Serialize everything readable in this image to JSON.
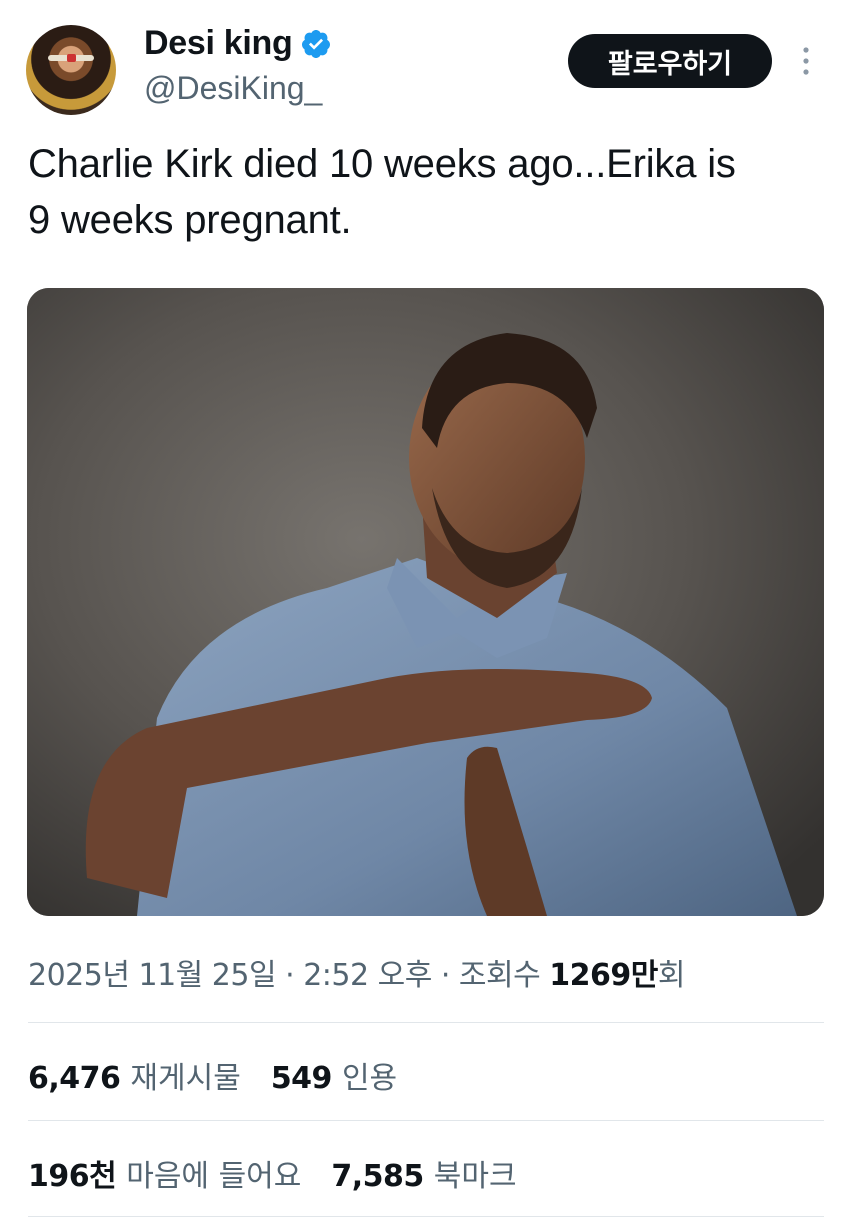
{
  "header": {
    "display_name": "Desi king",
    "handle": "@DesiKing_",
    "follow_label": "팔로우하기",
    "verified_icon": "verified-badge-icon",
    "more_icon": "more-vertical-icon",
    "accent_color": "#1d9bf0"
  },
  "tweet": {
    "text_line1": "Charlie Kirk died 10 weeks ago...Erika is",
    "text_line2": "9 weeks pregnant."
  },
  "meta": {
    "date": "2025년 11월 25일",
    "separator": " · ",
    "time": "2:52 오후",
    "views_label": "조회수",
    "views_count": "1269",
    "views_unit_1": "만",
    "views_unit_2": "회"
  },
  "stats": {
    "reposts_count": "6,476",
    "reposts_label": "재게시물",
    "quotes_count": "549",
    "quotes_label": "인용",
    "likes_count": "196천",
    "likes_label": "마음에 들어요",
    "bookmarks_count": "7,585",
    "bookmarks_label": "북마크"
  }
}
